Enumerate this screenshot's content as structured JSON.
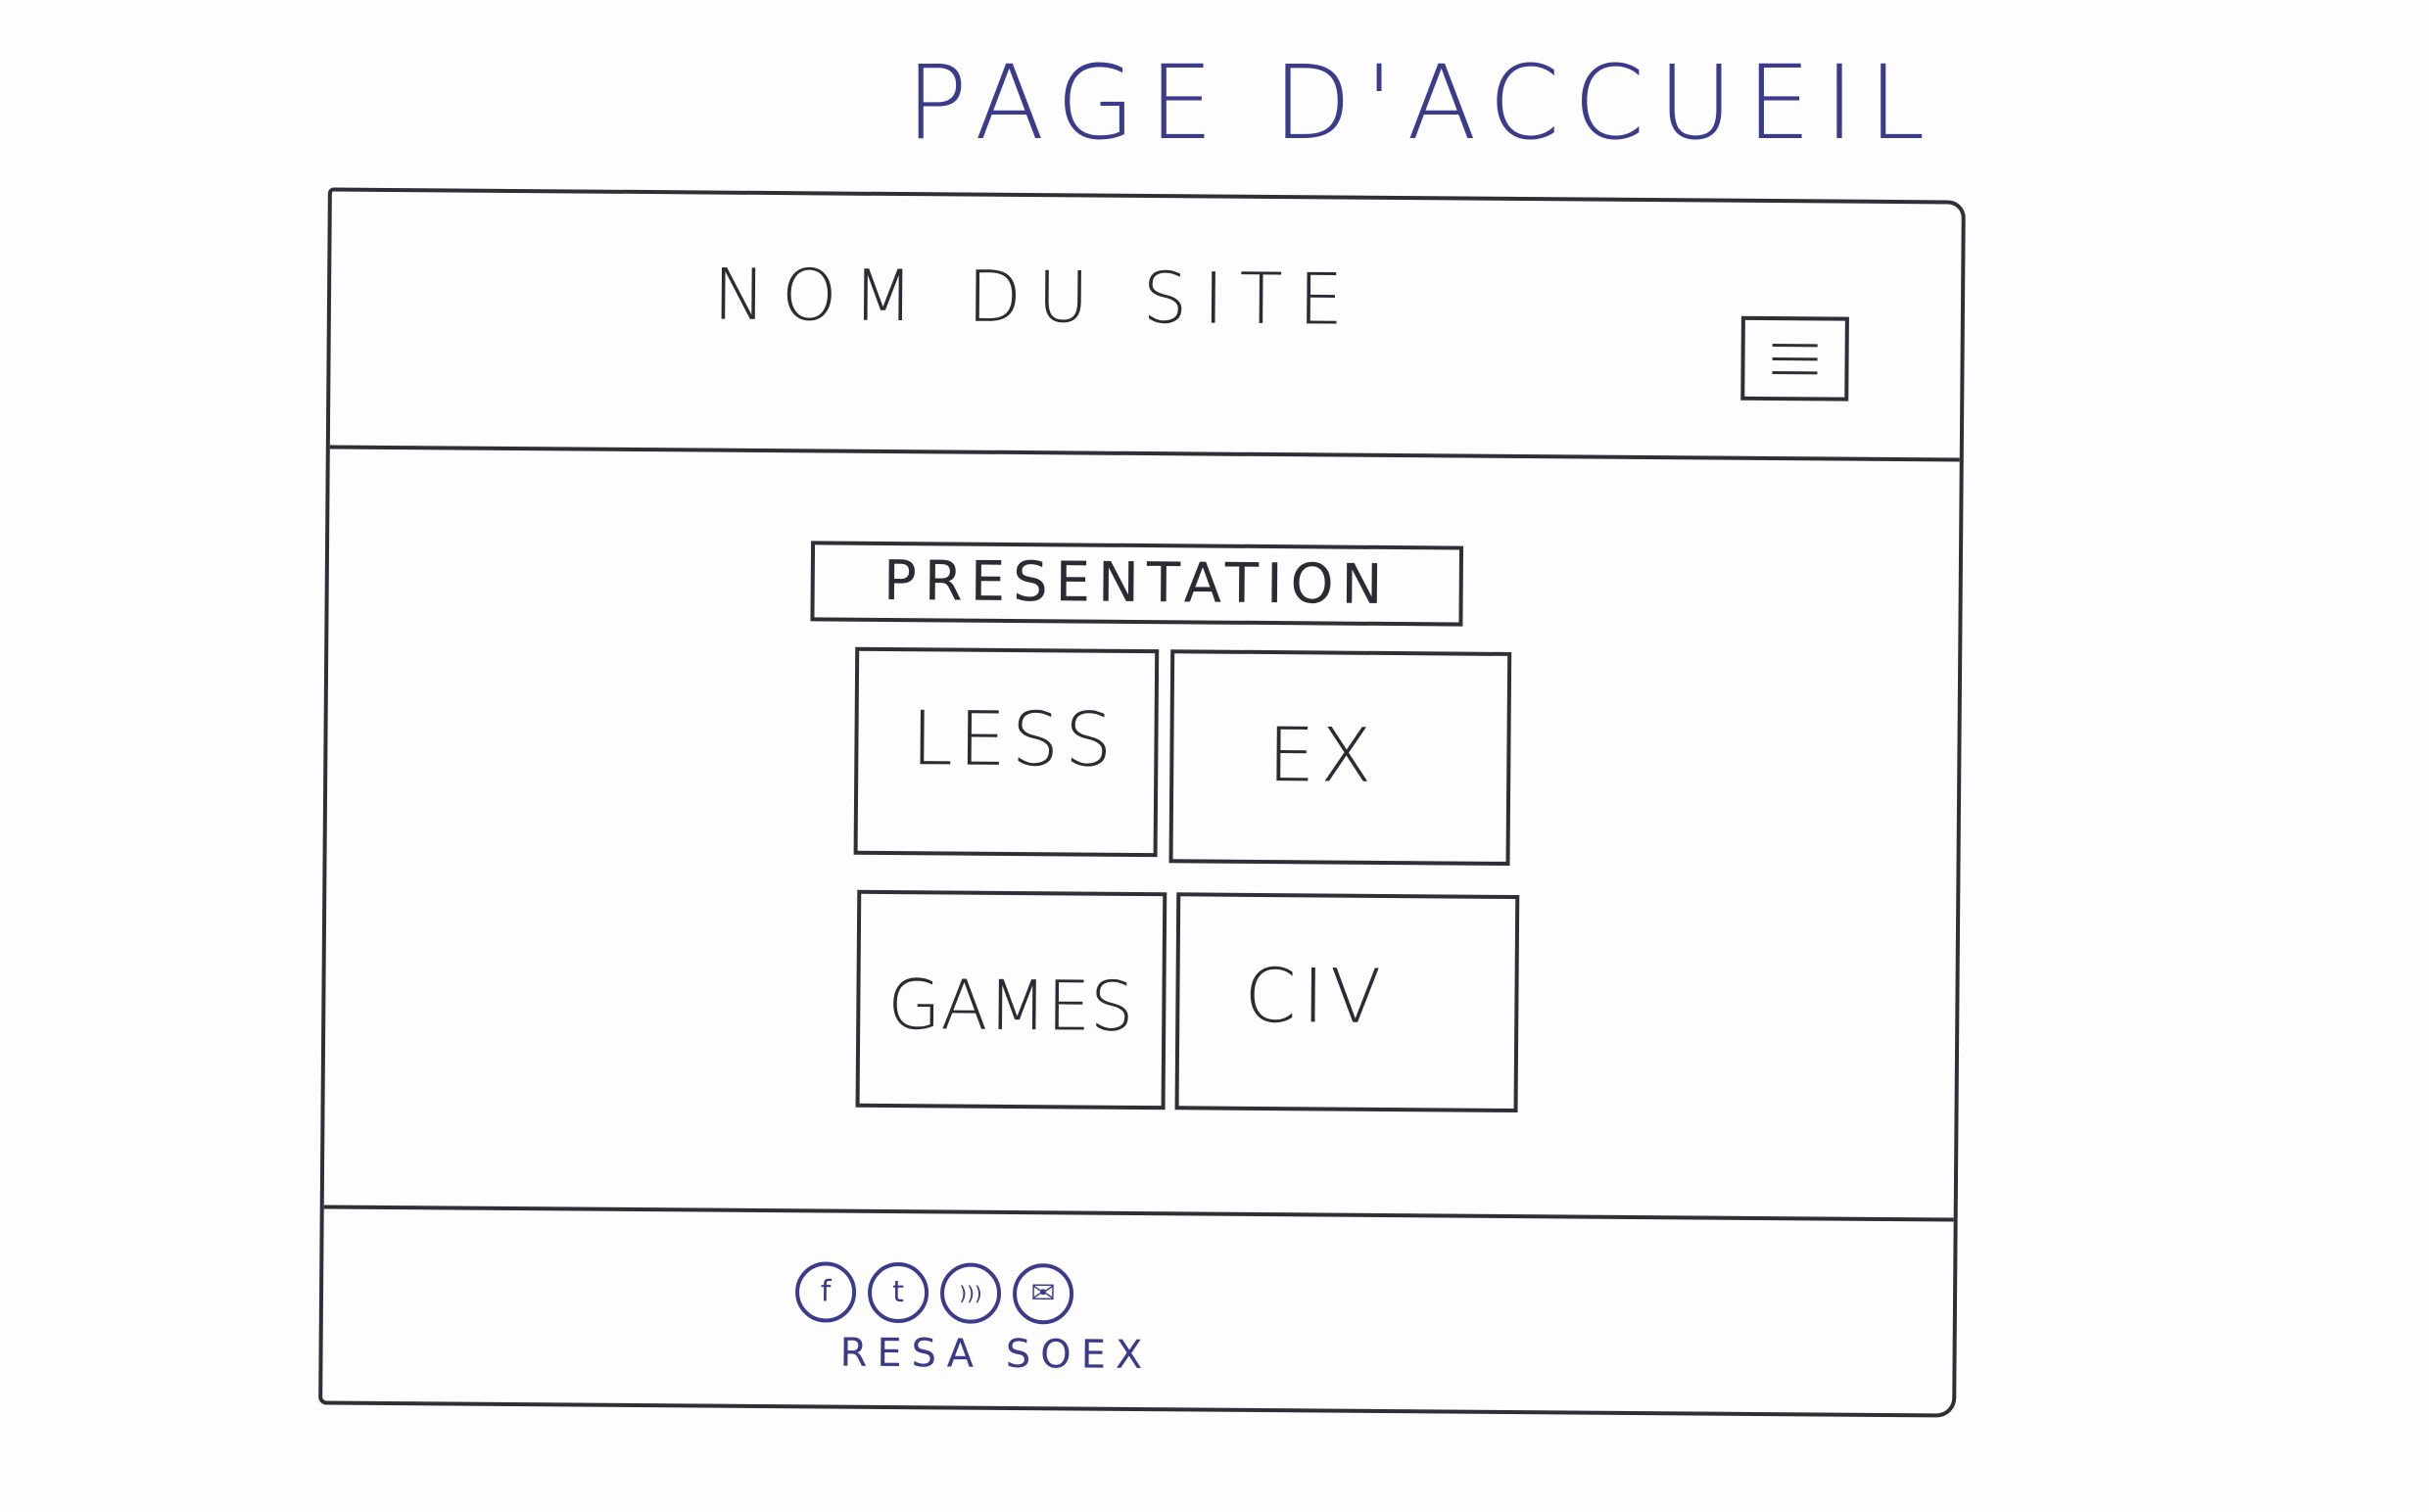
{
  "page": {
    "heading": "PAGE D'ACCUEIL"
  },
  "header": {
    "site_name": "NOM DU SITE",
    "menu_icon": "hamburger-menu-icon"
  },
  "main": {
    "presentation_label": "PRESENTATION",
    "tiles": [
      {
        "label": "LESS"
      },
      {
        "label": "EX"
      },
      {
        "label": "GAMES"
      },
      {
        "label": "CIV"
      }
    ]
  },
  "footer": {
    "social_icons": [
      {
        "name": "facebook-icon",
        "glyph": "f"
      },
      {
        "name": "twitter-icon",
        "glyph": "t"
      },
      {
        "name": "rss-icon",
        "glyph": ")))"
      },
      {
        "name": "mail-icon",
        "glyph": "✉"
      }
    ],
    "social_label": "RESA SOEX"
  },
  "colors": {
    "ink": "#2f2f38",
    "pen_blue": "#3b3b8c",
    "paper": "#fdfdfd"
  }
}
